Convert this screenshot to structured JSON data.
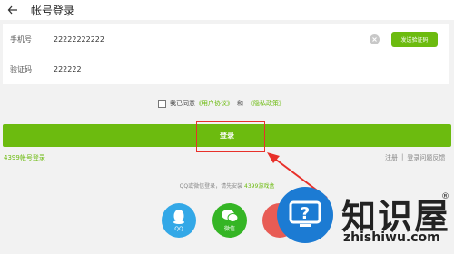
{
  "header": {
    "title": "帐号登录"
  },
  "form": {
    "phone_label": "手机号",
    "phone_value": "22222222222",
    "send_code_label": "发送验证码",
    "code_label": "验证码",
    "code_value": "222222"
  },
  "agreement": {
    "prefix": "我已同意",
    "user_agreement": "《用户协议》",
    "and": "和",
    "privacy_policy": "《隐私政策》"
  },
  "login_button": "登录",
  "links": {
    "account_login": "4399帐号登录",
    "register": "注册",
    "separator": "|",
    "feedback": "登录问题反馈"
  },
  "social": {
    "hint_prefix": "QQ或微信登录，请先安装",
    "hint_app": "4399游戏盒",
    "qq": "QQ",
    "wechat": "微信"
  },
  "watermark": {
    "big": "知识屋",
    "small": "zhishiwu.com",
    "reg": "®"
  },
  "colors": {
    "accent_green": "#6cbb0f",
    "highlight_red": "#e8302a",
    "qq_blue": "#33a8e7",
    "wechat_green": "#35b525",
    "weibo_red": "#e85c55"
  },
  "icons": [
    "back-arrow-icon",
    "clear-icon",
    "qq-icon",
    "wechat-icon",
    "watermark-logo-icon"
  ]
}
